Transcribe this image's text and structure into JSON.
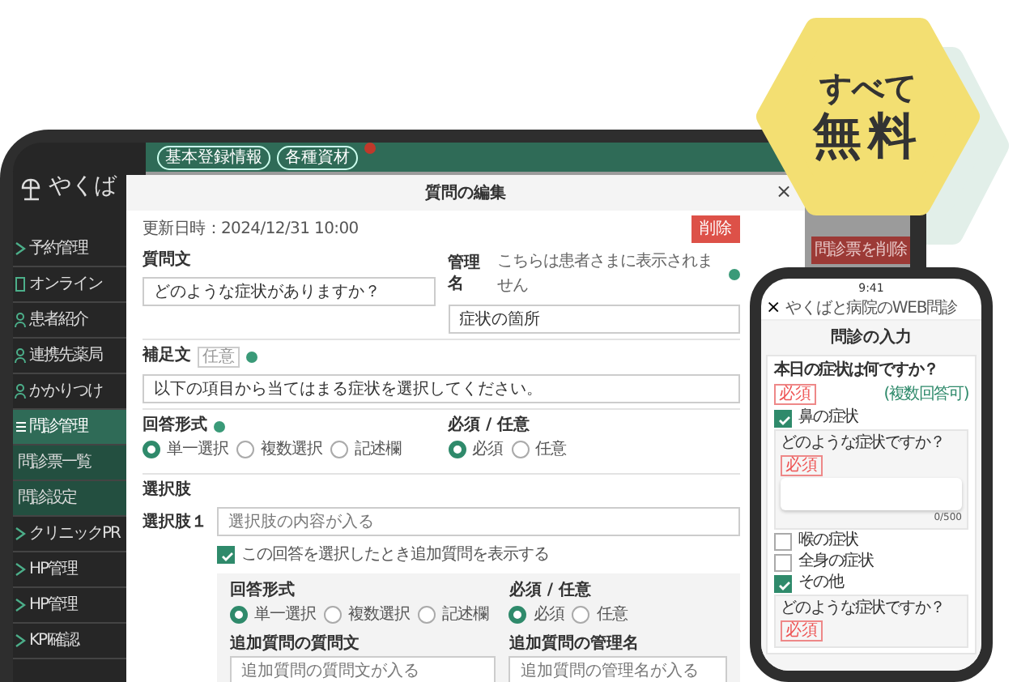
{
  "promo": {
    "lines": [
      "すべて",
      "無料"
    ]
  },
  "tablet": {
    "logo": "やくば",
    "sidebar": [
      {
        "label": "予約管理",
        "kind": "main",
        "selected": false
      },
      {
        "label": "オンライン",
        "kind": "main",
        "selected": false
      },
      {
        "label": "患者紹介",
        "kind": "main",
        "selected": false
      },
      {
        "label": "連携先薬局",
        "kind": "main",
        "selected": false
      },
      {
        "label": "かかりつけ",
        "kind": "main",
        "selected": false
      },
      {
        "label": "問診管理",
        "kind": "main",
        "selected": true
      },
      {
        "label": "問診票一覧",
        "kind": "sub",
        "selected": false
      },
      {
        "label": "問診設定",
        "kind": "sub",
        "selected": false
      },
      {
        "label": "クリニックPR",
        "kind": "main",
        "selected": false
      },
      {
        "label": "HP管理",
        "kind": "main",
        "selected": false
      },
      {
        "label": "HP管理",
        "kind": "main",
        "selected": false
      },
      {
        "label": "KPI確認",
        "kind": "main",
        "selected": false
      }
    ],
    "top_tabs": [
      "基本登録情報",
      "各種資材"
    ],
    "behind_button": "問診票を削除"
  },
  "modal": {
    "title": "質問の編集",
    "close": "×",
    "updated": "更新日時：2024/12/31 10:00",
    "delete": "削除",
    "question": {
      "label": "質問文",
      "value": "どのような症状がありますか？"
    },
    "admin_name": {
      "label": "管理名",
      "hint": "こちらは患者さまに表示されません",
      "value": "症状の箇所"
    },
    "supplement": {
      "label": "補足文",
      "tag": "任意",
      "value": "以下の項目から当てはまる症状を選択してください。"
    },
    "answer_type": {
      "label": "回答形式",
      "options": [
        {
          "label": "単一選択",
          "selected": true
        },
        {
          "label": "複数選択",
          "selected": false
        },
        {
          "label": "記述欄",
          "selected": false
        }
      ]
    },
    "required": {
      "label": "必須 / 任意",
      "options": [
        {
          "label": "必須",
          "selected": true
        },
        {
          "label": "任意",
          "selected": false
        }
      ]
    },
    "choices_label": "選択肢",
    "choice": {
      "label": "選択肢１",
      "placeholder": "選択肢の内容が入る",
      "followup_toggle": {
        "label": "この回答を選択したとき追加質問を表示する",
        "checked": true
      },
      "followup": {
        "answer_type": {
          "label": "回答形式",
          "options": [
            {
              "label": "単一選択",
              "selected": true
            },
            {
              "label": "複数選択",
              "selected": false
            },
            {
              "label": "記述欄",
              "selected": false
            }
          ]
        },
        "required": {
          "label": "必須 / 任意",
          "options": [
            {
              "label": "必須",
              "selected": true
            },
            {
              "label": "任意",
              "selected": false
            }
          ]
        },
        "question": {
          "label": "追加質問の質問文",
          "placeholder": "追加質問の質問文が入る"
        },
        "admin_name": {
          "label": "追加質問の管理名",
          "placeholder": "追加質問の管理名が入る"
        }
      }
    }
  },
  "phone": {
    "time": "9:41",
    "close": "×",
    "header": "やくばと病院のWEB問診",
    "title": "問診の入力",
    "question": "本日の症状は何ですか？",
    "tag": "必須",
    "note": "(複数回答可)",
    "options": [
      {
        "label": "鼻の症状",
        "checked": true,
        "followup": {
          "question": "どのような症状ですか？",
          "tag": "必須",
          "counter": "0/500"
        }
      },
      {
        "label": "喉の症状",
        "checked": false
      },
      {
        "label": "全身の症状",
        "checked": false
      },
      {
        "label": "その他",
        "checked": true,
        "followup": {
          "question": "どのような症状ですか？",
          "tag": "必須"
        }
      }
    ]
  }
}
